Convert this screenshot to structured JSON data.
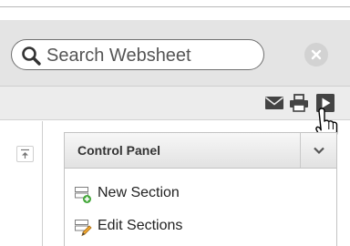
{
  "search": {
    "placeholder": "Search Websheet"
  },
  "toolbar": {
    "buttons": [
      {
        "icon": "email-icon"
      },
      {
        "icon": "print-icon"
      },
      {
        "icon": "present-icon"
      }
    ]
  },
  "control_panel": {
    "title": "Control Panel",
    "items": [
      {
        "label": "New Section",
        "icon": "new-section-icon"
      },
      {
        "label": "Edit Sections",
        "icon": "edit-sections-icon"
      }
    ]
  },
  "colors": {
    "header_bg": "#e4e4e4",
    "toolbar_bg": "#ececec",
    "panel_header_bg": "#e2e2e2"
  }
}
